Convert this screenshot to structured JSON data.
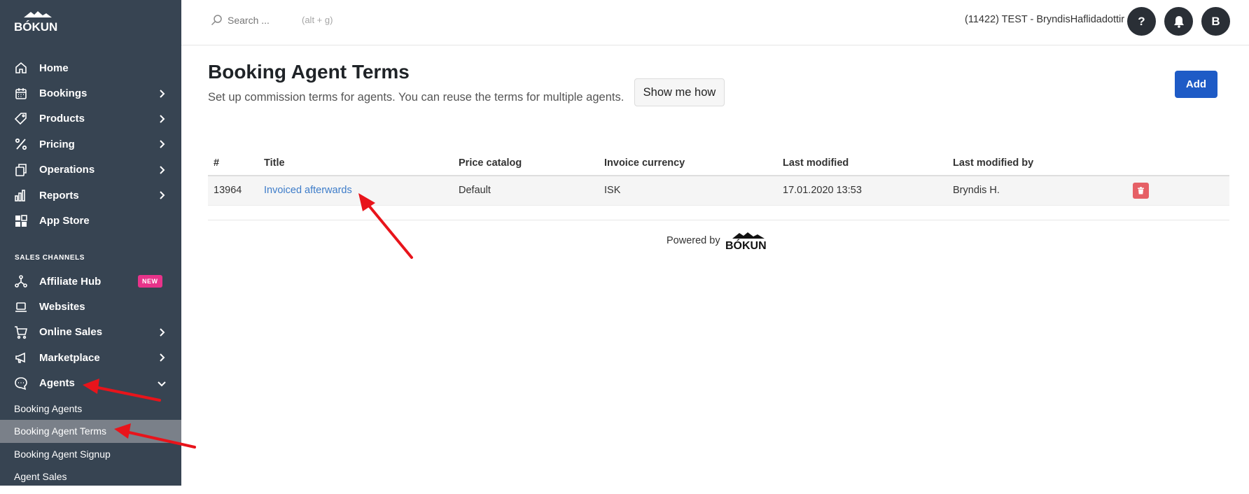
{
  "brand": {
    "name": "BÓKUN",
    "powered_by": "Powered by"
  },
  "sidebar": {
    "items": [
      {
        "label": "Home",
        "icon": "home-icon",
        "chevron": false
      },
      {
        "label": "Bookings",
        "icon": "calendar-icon",
        "chevron": true
      },
      {
        "label": "Products",
        "icon": "tag-icon",
        "chevron": true
      },
      {
        "label": "Pricing",
        "icon": "percent-icon",
        "chevron": true
      },
      {
        "label": "Operations",
        "icon": "copy-icon",
        "chevron": true
      },
      {
        "label": "Reports",
        "icon": "bar-chart-icon",
        "chevron": true
      },
      {
        "label": "App Store",
        "icon": "grid-icon",
        "chevron": false
      }
    ],
    "section_title": "SALES CHANNELS",
    "channel_items": [
      {
        "label": "Affiliate Hub",
        "icon": "network-icon",
        "badge": "NEW"
      },
      {
        "label": "Websites",
        "icon": "laptop-icon"
      },
      {
        "label": "Online Sales",
        "icon": "cart-icon",
        "chevron": true
      },
      {
        "label": "Marketplace",
        "icon": "megaphone-icon",
        "chevron": true
      },
      {
        "label": "Agents",
        "icon": "chat-icon",
        "expanded": true
      }
    ],
    "sub_items": [
      {
        "label": "Booking Agents",
        "active": false
      },
      {
        "label": "Booking Agent Terms",
        "active": true
      },
      {
        "label": "Booking Agent Signup",
        "active": false
      },
      {
        "label": "Agent Sales",
        "active": false
      }
    ]
  },
  "topbar": {
    "search_placeholder": "Search ...",
    "search_hint": "(alt + g)",
    "account": "(11422) TEST - BryndisHaflidadottir",
    "help_label": "?",
    "avatar_label": "B"
  },
  "main": {
    "title": "Booking Agent Terms",
    "subtitle": "Set up commission terms for agents. You can reuse the terms for multiple agents.",
    "show_me_how": "Show me how",
    "add_label": "Add",
    "table": {
      "headers": [
        "#",
        "Title",
        "Price catalog",
        "Invoice currency",
        "Last modified",
        "Last modified by"
      ],
      "rows": [
        {
          "id": "13964",
          "title": "Invoiced afterwards",
          "price_catalog": "Default",
          "currency": "ISK",
          "modified": "17.01.2020 13:53",
          "modified_by": "Bryndis H."
        }
      ]
    }
  },
  "colors": {
    "sidebar_bg": "#374452",
    "active_sub_bg": "#7a8089",
    "primary_button": "#1e5bc6",
    "link": "#3d7cc9",
    "badge_new": "#e8338a",
    "delete_button": "#e66066",
    "annotation_arrow": "#e8141b"
  }
}
